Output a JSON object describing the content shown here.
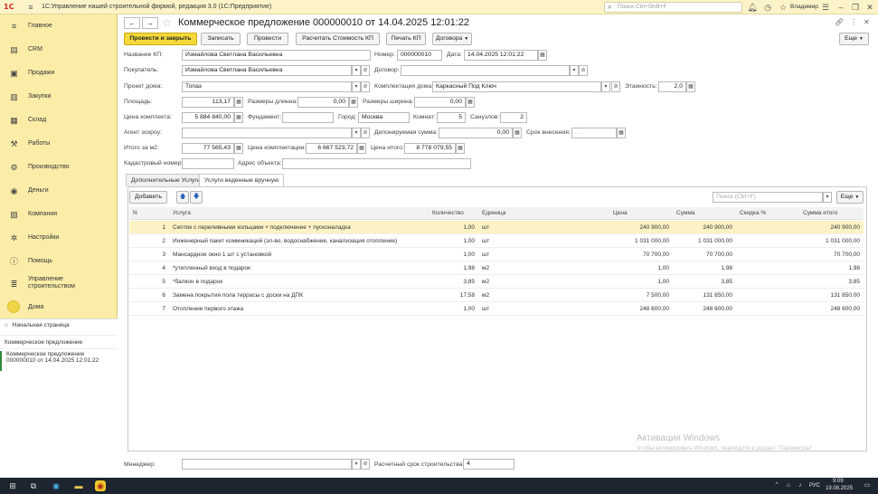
{
  "app": {
    "title": "1С:Управление нашей строительной фирмой, редакция 3.0  (1С:Предприятие)",
    "logo": "1С",
    "search_placeholder": "Поиск Ctrl+Shift+F",
    "user": "Владимир"
  },
  "sidebar": {
    "items": [
      {
        "label": "Главное",
        "icon": "menu-icon"
      },
      {
        "label": "CRM",
        "icon": "crm-icon"
      },
      {
        "label": "Продажи",
        "icon": "sales-icon"
      },
      {
        "label": "Закупки",
        "icon": "purchases-icon"
      },
      {
        "label": "Склад",
        "icon": "warehouse-icon"
      },
      {
        "label": "Работы",
        "icon": "works-icon"
      },
      {
        "label": "Производство",
        "icon": "production-icon"
      },
      {
        "label": "Деньги",
        "icon": "money-icon"
      },
      {
        "label": "Компания",
        "icon": "company-icon"
      },
      {
        "label": "Настройки",
        "icon": "settings-icon"
      },
      {
        "label": "Помощь",
        "icon": "help-icon"
      },
      {
        "label": "Управление строительством",
        "icon": "construction-icon"
      },
      {
        "label": "Дома",
        "icon": "house-icon"
      }
    ],
    "home": "Начальная страница",
    "section": "Коммерческое предложение",
    "open_doc_line1": "Коммерческое предложение",
    "open_doc_line2": "000000010 от 14.04.2025 12:01:22"
  },
  "doc": {
    "title": "Коммерческое предложение 000000010 от 14.04.2025 12:01:22"
  },
  "toolbar": {
    "post_close": "Провести и закрыть",
    "save": "Записать",
    "post": "Провести",
    "calc": "Расчитать Стоимость КП",
    "print": "Печать КП",
    "contracts": "Договора",
    "more": "Еще"
  },
  "form": {
    "name_label": "Название КП:",
    "name_value": "Измайлова Светлана Васильевна",
    "number_label": "Номер:",
    "number_value": "000000010",
    "date_label": "Дата:",
    "date_value": "14.04.2025 12:01:22",
    "buyer_label": "Покупатель:",
    "buyer_value": "Измайлова Светлана Васильевна",
    "contract_label": "Договор:",
    "contract_value": "",
    "project_label": "Проект дома:",
    "project_value": "Топаз",
    "kit_label": "Комплектация дома:",
    "kit_value": "Каркасный Под Ключ",
    "floors_label": "Этажность:",
    "floors_value": "2,0",
    "area_label": "Площадь:",
    "area_value": "113,17",
    "length_label": "Размеры длинна:",
    "length_value": "0,00",
    "width_label": "Размеры ширина:",
    "width_value": "0,00",
    "kitprice_label": "Цена комплекта:",
    "kitprice_value": "5 884 840,00",
    "foundation_label": "Фундамент:",
    "foundation_value": "",
    "city_label": "Город:",
    "city_value": "Москва",
    "rooms_label": "Комнат:",
    "rooms_value": "5",
    "bathrooms_label": "Санузлов:",
    "bathrooms_value": "2",
    "agent_label": "Агент эскроу:",
    "agent_value": "",
    "deposit_label": "Депонируемая сумма:",
    "deposit_value": "0,00",
    "term_label": "Срок внесения:",
    "term_value": ". .",
    "perm2_label": "Итого за м2:",
    "perm2_value": "77 565,43",
    "kitpricetotal_label": "Цена комплектации:",
    "kitpricetotal_value": "6 667 523,72",
    "total_label": "Цена итого:",
    "total_value": "8 778 079,55",
    "cadastral_label": "Кадастровый номер:",
    "cadastral_value": "",
    "address_label": "Адрес объекта:",
    "address_value": "",
    "manager_label": "Менеджер:",
    "manager_value": "",
    "buildterm_label": "Расчетный срок строительства:",
    "buildterm_value": "4"
  },
  "tabs": [
    "Дополнительные Услуги",
    "Услуги веденные вручную"
  ],
  "grid": {
    "add": "Добавить",
    "search_placeholder": "Поиск (Ctrl+F)",
    "more": "Еще",
    "columns": [
      "N",
      "Услуга",
      "Количество",
      "Единица",
      "Цена",
      "Сумма",
      "Скидка %",
      "Сумма итого"
    ],
    "rows": [
      {
        "n": "1",
        "service": "Септик с переливными кольцами + подключение + пусконаладка",
        "qty": "1,00",
        "unit": "шт",
        "price": "240 900,00",
        "sum": "240 900,00",
        "disc": "",
        "total": "240 900,00"
      },
      {
        "n": "2",
        "service": "Инженерный пакет коммникаций (эл-во, водоснабжение, канализация отопление)",
        "qty": "1,00",
        "unit": "шт",
        "price": "1 031 000,00",
        "sum": "1 031 000,00",
        "disc": "",
        "total": "1 031 000,00"
      },
      {
        "n": "3",
        "service": "Мансардное окно 1 шт с установкой",
        "qty": "1,00",
        "unit": "шт",
        "price": "70 700,00",
        "sum": "70 700,00",
        "disc": "",
        "total": "70 700,00"
      },
      {
        "n": "4",
        "service": "*утепленный вход в подарок",
        "qty": "1,98",
        "unit": "м2",
        "price": "1,00",
        "sum": "1,98",
        "disc": "",
        "total": "1,98"
      },
      {
        "n": "5",
        "service": "*балкон в подарок",
        "qty": "3,85",
        "unit": "м2",
        "price": "1,00",
        "sum": "3,85",
        "disc": "",
        "total": "3,85"
      },
      {
        "n": "6",
        "service": "Замена покрытия пола террасы с доски на ДПК",
        "qty": "17,58",
        "unit": "м2",
        "price": "7 500,00",
        "sum": "131 850,00",
        "disc": "",
        "total": "131 850,00"
      },
      {
        "n": "7",
        "service": "Отопление первого этажа",
        "qty": "1,00",
        "unit": "шт",
        "price": "248 600,00",
        "sum": "248 600,00",
        "disc": "",
        "total": "248 600,00"
      }
    ]
  },
  "watermark": {
    "line1": "Активация Windows",
    "line2": "Чтобы активировать Windows, перейдите в раздел \"Параметры\"."
  },
  "taskbar": {
    "lang": "РУС",
    "time": "9:09",
    "date": "19.08.2025"
  }
}
